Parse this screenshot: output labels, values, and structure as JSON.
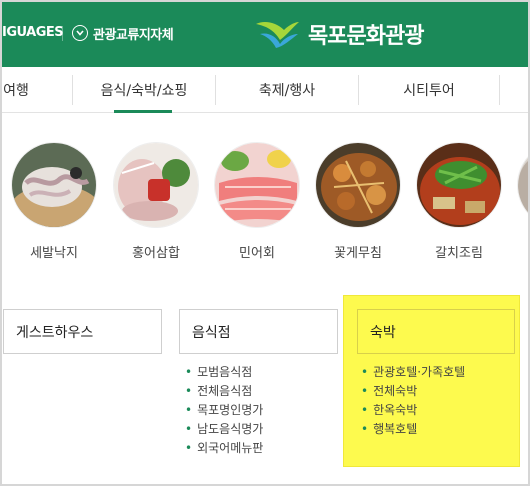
{
  "header": {
    "languages_label": "IGUAGES",
    "gov_link_label": "관광교류지자체",
    "logo_text": "목포문화관광"
  },
  "nav": {
    "items": [
      {
        "label": "여행"
      },
      {
        "label": "음식/숙박/쇼핑"
      },
      {
        "label": "축제/행사"
      },
      {
        "label": "시티투어"
      }
    ],
    "active": "음식/숙박/쇼핑"
  },
  "foods": [
    {
      "label": "세발낙지"
    },
    {
      "label": "홍어삼합"
    },
    {
      "label": "민어회"
    },
    {
      "label": "꽃게무침"
    },
    {
      "label": "갈치조림"
    }
  ],
  "categories": {
    "guesthouse": {
      "title": "게스트하우스"
    },
    "restaurant": {
      "title": "음식점",
      "items": [
        "모범음식점",
        "전체음식점",
        "목포명인명가",
        "남도음식명가",
        "외국어메뉴판"
      ]
    },
    "lodging": {
      "title": "숙박",
      "items": [
        "관광호텔·가족호텔",
        "전체숙박",
        "한옥숙박",
        "행복호텔"
      ],
      "highlight_color": "#fdfa4e"
    }
  },
  "colors": {
    "brand_green": "#1b8a59"
  }
}
